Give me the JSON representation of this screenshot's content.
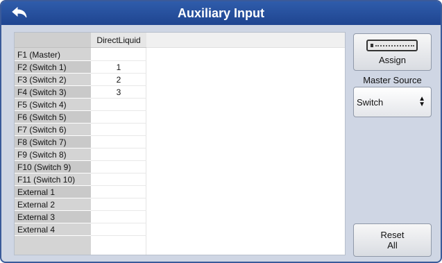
{
  "window": {
    "title": "Auxiliary Input"
  },
  "table": {
    "column_header": "DirectLiquid",
    "rows": [
      {
        "label": "F1 (Master)",
        "value": ""
      },
      {
        "label": "F2 (Switch 1)",
        "value": "1"
      },
      {
        "label": "F3 (Switch 2)",
        "value": "2"
      },
      {
        "label": "F4 (Switch 3)",
        "value": "3"
      },
      {
        "label": "F5 (Switch 4)",
        "value": ""
      },
      {
        "label": "F6 (Switch 5)",
        "value": ""
      },
      {
        "label": "F7 (Switch 6)",
        "value": ""
      },
      {
        "label": "F8 (Switch 7)",
        "value": ""
      },
      {
        "label": "F9 (Switch 8)",
        "value": ""
      },
      {
        "label": "F10 (Switch 9)",
        "value": ""
      },
      {
        "label": "F11 (Switch 10)",
        "value": ""
      },
      {
        "label": "External 1",
        "value": ""
      },
      {
        "label": "External 2",
        "value": ""
      },
      {
        "label": "External 3",
        "value": ""
      },
      {
        "label": "External 4",
        "value": ""
      }
    ]
  },
  "side": {
    "assign_label": "Assign",
    "master_source_label": "Master Source",
    "master_source_value": "Switch",
    "reset_label": "Reset\nAll"
  },
  "icons": {
    "back": "back-arrow-icon",
    "assign": "keypad-icon",
    "select_arrows": "up-down-arrows-icon"
  },
  "colors": {
    "titlebar": "#2a56a5",
    "frame": "#cfd6e4"
  }
}
